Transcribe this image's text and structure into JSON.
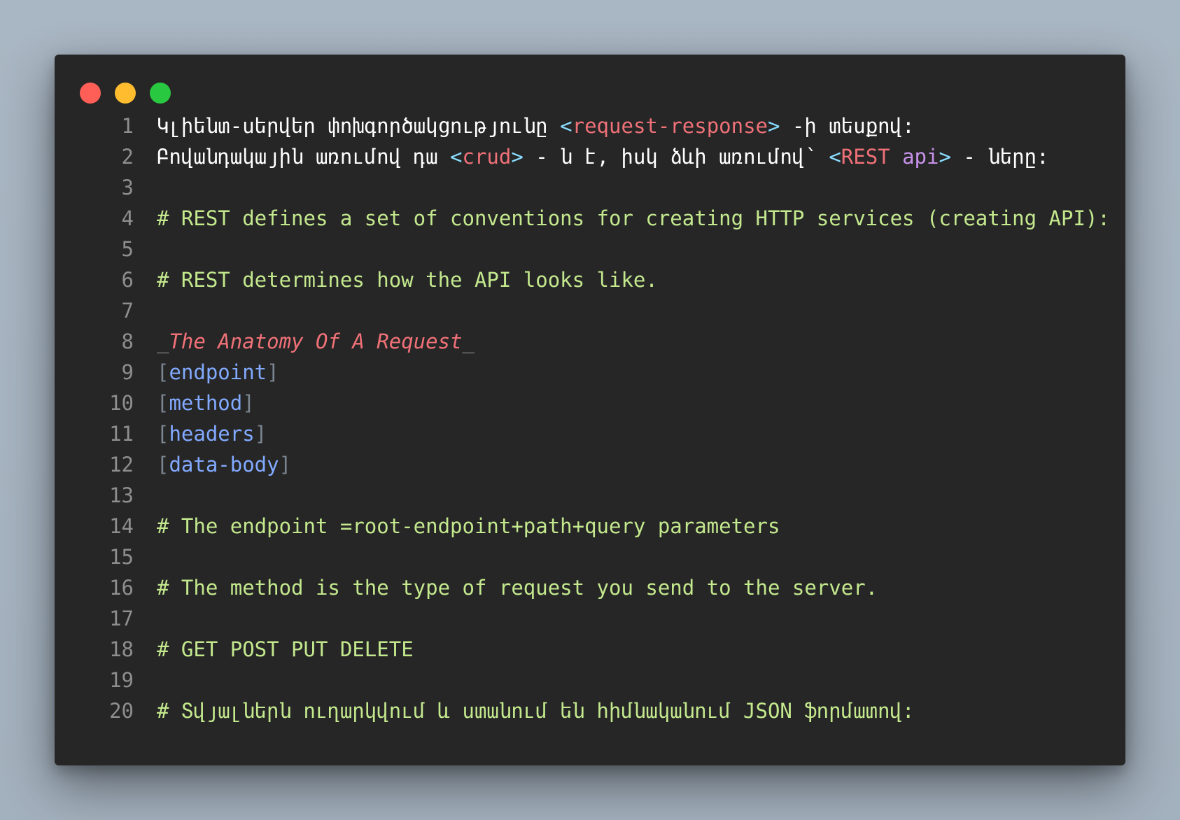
{
  "window": {
    "traffic_lights": [
      "close",
      "minimize",
      "maximize"
    ],
    "colors": {
      "close": "#ff5f57",
      "minimize": "#febc2e",
      "maximize": "#28c840",
      "background": "#262626"
    }
  },
  "lines": [
    {
      "n": "1",
      "tokens": [
        {
          "t": "Կլիենտ-սերվեր փոխգործակցությունը ",
          "c": "plain"
        },
        {
          "t": "<",
          "c": "tag"
        },
        {
          "t": "request-response",
          "c": "val"
        },
        {
          "t": ">",
          "c": "tag"
        },
        {
          "t": " -ի տեսքով:",
          "c": "plain"
        }
      ]
    },
    {
      "n": "2",
      "tokens": [
        {
          "t": "Բովանդակային առումով դա ",
          "c": "plain"
        },
        {
          "t": "<",
          "c": "tag"
        },
        {
          "t": "crud",
          "c": "val"
        },
        {
          "t": ">",
          "c": "tag"
        },
        {
          "t": " - ն է, իսկ ձևի առումով՝ ",
          "c": "plain"
        },
        {
          "t": "<",
          "c": "tag"
        },
        {
          "t": "REST",
          "c": "val"
        },
        {
          "t": " ",
          "c": "plain"
        },
        {
          "t": "api",
          "c": "attr"
        },
        {
          "t": ">",
          "c": "tag"
        },
        {
          "t": " - ները:",
          "c": "plain"
        }
      ]
    },
    {
      "n": "3",
      "tokens": []
    },
    {
      "n": "4",
      "tokens": [
        {
          "t": "# REST defines a set of conventions for creating HTTP services (creating API):",
          "c": "comment"
        }
      ]
    },
    {
      "n": "5",
      "tokens": []
    },
    {
      "n": "6",
      "tokens": [
        {
          "t": "# REST determines how the API looks like.",
          "c": "comment"
        }
      ]
    },
    {
      "n": "7",
      "tokens": []
    },
    {
      "n": "8",
      "tokens": [
        {
          "t": "_",
          "c": "under"
        },
        {
          "t": "The Anatomy Of A Request",
          "c": "ital"
        },
        {
          "t": "_",
          "c": "under"
        }
      ]
    },
    {
      "n": "9",
      "tokens": [
        {
          "t": "[",
          "c": "bracket"
        },
        {
          "t": "endpoint",
          "c": "link"
        },
        {
          "t": "]",
          "c": "bracket"
        }
      ]
    },
    {
      "n": "10",
      "tokens": [
        {
          "t": "[",
          "c": "bracket"
        },
        {
          "t": "method",
          "c": "link"
        },
        {
          "t": "]",
          "c": "bracket"
        }
      ]
    },
    {
      "n": "11",
      "tokens": [
        {
          "t": "[",
          "c": "bracket"
        },
        {
          "t": "headers",
          "c": "link"
        },
        {
          "t": "]",
          "c": "bracket"
        }
      ]
    },
    {
      "n": "12",
      "tokens": [
        {
          "t": "[",
          "c": "bracket"
        },
        {
          "t": "data-body",
          "c": "link"
        },
        {
          "t": "]",
          "c": "bracket"
        }
      ]
    },
    {
      "n": "13",
      "tokens": []
    },
    {
      "n": "14",
      "tokens": [
        {
          "t": "# The endpoint =root-endpoint+path+query parameters",
          "c": "comment"
        }
      ]
    },
    {
      "n": "15",
      "tokens": []
    },
    {
      "n": "16",
      "tokens": [
        {
          "t": "# The method is the type of request you send to the server.",
          "c": "comment"
        }
      ]
    },
    {
      "n": "17",
      "tokens": []
    },
    {
      "n": "18",
      "tokens": [
        {
          "t": "# GET POST PUT DELETE",
          "c": "comment"
        }
      ]
    },
    {
      "n": "19",
      "tokens": []
    },
    {
      "n": "20",
      "tokens": [
        {
          "t": "# Տվյալներն ուղարկվում և ստանում են հիմնականում JSON ֆորմատով:",
          "c": "comment"
        }
      ]
    }
  ]
}
